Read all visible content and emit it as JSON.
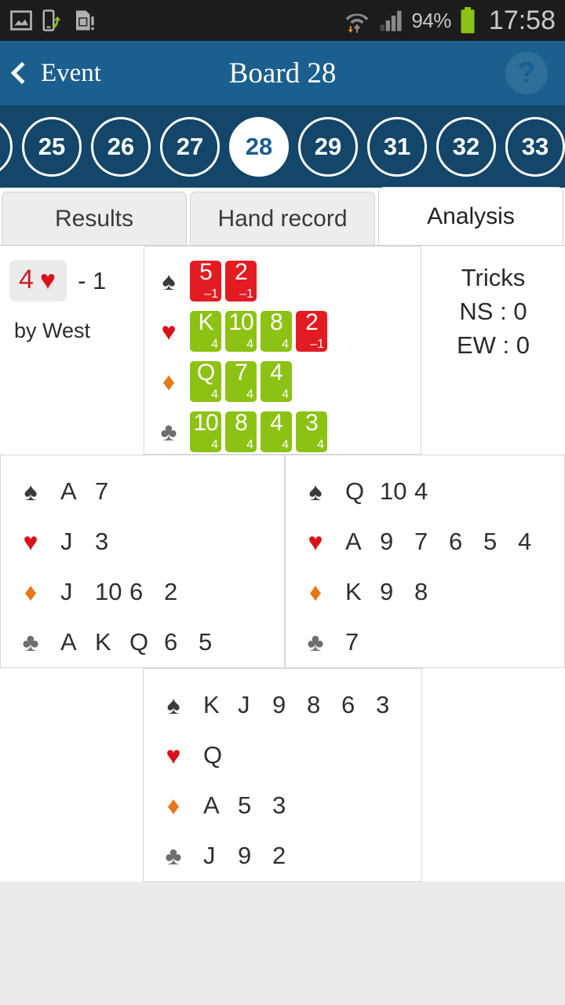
{
  "status_bar": {
    "icons_left": [
      "screenshot-icon",
      "usb-transfer-icon",
      "sim-card-icon"
    ],
    "icons_right": [
      "wifi-icon",
      "signal-icon",
      "battery-icon"
    ],
    "battery_percent": "94%",
    "clock": "17:58"
  },
  "action_bar": {
    "back_label": "Event",
    "title": "Board 28",
    "help_label": "?"
  },
  "board_strip": {
    "boards": [
      "25",
      "26",
      "27",
      "28",
      "29",
      "31",
      "32",
      "33"
    ],
    "selected": "28"
  },
  "tabs": [
    {
      "label": "Results",
      "active": false
    },
    {
      "label": "Hand record",
      "active": false
    },
    {
      "label": "Analysis",
      "active": true
    }
  ],
  "contract": {
    "level": "4",
    "suit": "heart",
    "suit_glyph": "♥",
    "result": "- 1",
    "declarer": "by West"
  },
  "tricks": {
    "title": "Tricks",
    "ns": "NS : 0",
    "ew": "EW : 0"
  },
  "play_analysis": {
    "rows": [
      {
        "suit": "spade",
        "glyph": "♠",
        "cards": [
          {
            "rank": "5",
            "tricks": "–1",
            "color": "red"
          },
          {
            "rank": "2",
            "tricks": "–1",
            "color": "red"
          }
        ]
      },
      {
        "suit": "heart",
        "glyph": "♥",
        "cards": [
          {
            "rank": "K",
            "tricks": "4",
            "color": "green"
          },
          {
            "rank": "10",
            "tricks": "4",
            "color": "green"
          },
          {
            "rank": "8",
            "tricks": "4",
            "color": "green"
          },
          {
            "rank": "2",
            "tricks": "–1",
            "color": "red"
          }
        ]
      },
      {
        "suit": "diamond",
        "glyph": "♦",
        "cards": [
          {
            "rank": "Q",
            "tricks": "4",
            "color": "green"
          },
          {
            "rank": "7",
            "tricks": "4",
            "color": "green"
          },
          {
            "rank": "4",
            "tricks": "4",
            "color": "green"
          }
        ]
      },
      {
        "suit": "club",
        "glyph": "♣",
        "cards": [
          {
            "rank": "10",
            "tricks": "4",
            "color": "green"
          },
          {
            "rank": "8",
            "tricks": "4",
            "color": "green"
          },
          {
            "rank": "4",
            "tricks": "4",
            "color": "green"
          },
          {
            "rank": "3",
            "tricks": "4",
            "color": "green"
          }
        ]
      }
    ]
  },
  "hands": {
    "west": {
      "rows": [
        {
          "suit": "spade",
          "glyph": "♠",
          "cards": [
            "A",
            "7"
          ]
        },
        {
          "suit": "heart",
          "glyph": "♥",
          "cards": [
            "J",
            "3"
          ]
        },
        {
          "suit": "diamond",
          "glyph": "♦",
          "cards": [
            "J",
            "10",
            "6",
            "2"
          ]
        },
        {
          "suit": "club",
          "glyph": "♣",
          "cards": [
            "A",
            "K",
            "Q",
            "6",
            "5"
          ]
        }
      ]
    },
    "east": {
      "rows": [
        {
          "suit": "spade",
          "glyph": "♠",
          "cards": [
            "Q",
            "10",
            "4"
          ]
        },
        {
          "suit": "heart",
          "glyph": "♥",
          "cards": [
            "A",
            "9",
            "7",
            "6",
            "5",
            "4"
          ]
        },
        {
          "suit": "diamond",
          "glyph": "♦",
          "cards": [
            "K",
            "9",
            "8"
          ]
        },
        {
          "suit": "club",
          "glyph": "♣",
          "cards": [
            "7"
          ]
        }
      ]
    },
    "south": {
      "rows": [
        {
          "suit": "spade",
          "glyph": "♠",
          "cards": [
            "K",
            "J",
            "9",
            "8",
            "6",
            "3"
          ]
        },
        {
          "suit": "heart",
          "glyph": "♥",
          "cards": [
            "Q"
          ]
        },
        {
          "suit": "diamond",
          "glyph": "♦",
          "cards": [
            "A",
            "5",
            "3"
          ]
        },
        {
          "suit": "club",
          "glyph": "♣",
          "cards": [
            "J",
            "9",
            "2"
          ]
        }
      ]
    }
  },
  "colors": {
    "action_bar": "#1b5f8e",
    "board_strip": "#134668",
    "card_green": "#8cc213",
    "card_red": "#e31b23",
    "heart": "#d8121b",
    "diamond": "#e8761a",
    "spade": "#3a3a3a",
    "club": "#6e6e6e"
  }
}
